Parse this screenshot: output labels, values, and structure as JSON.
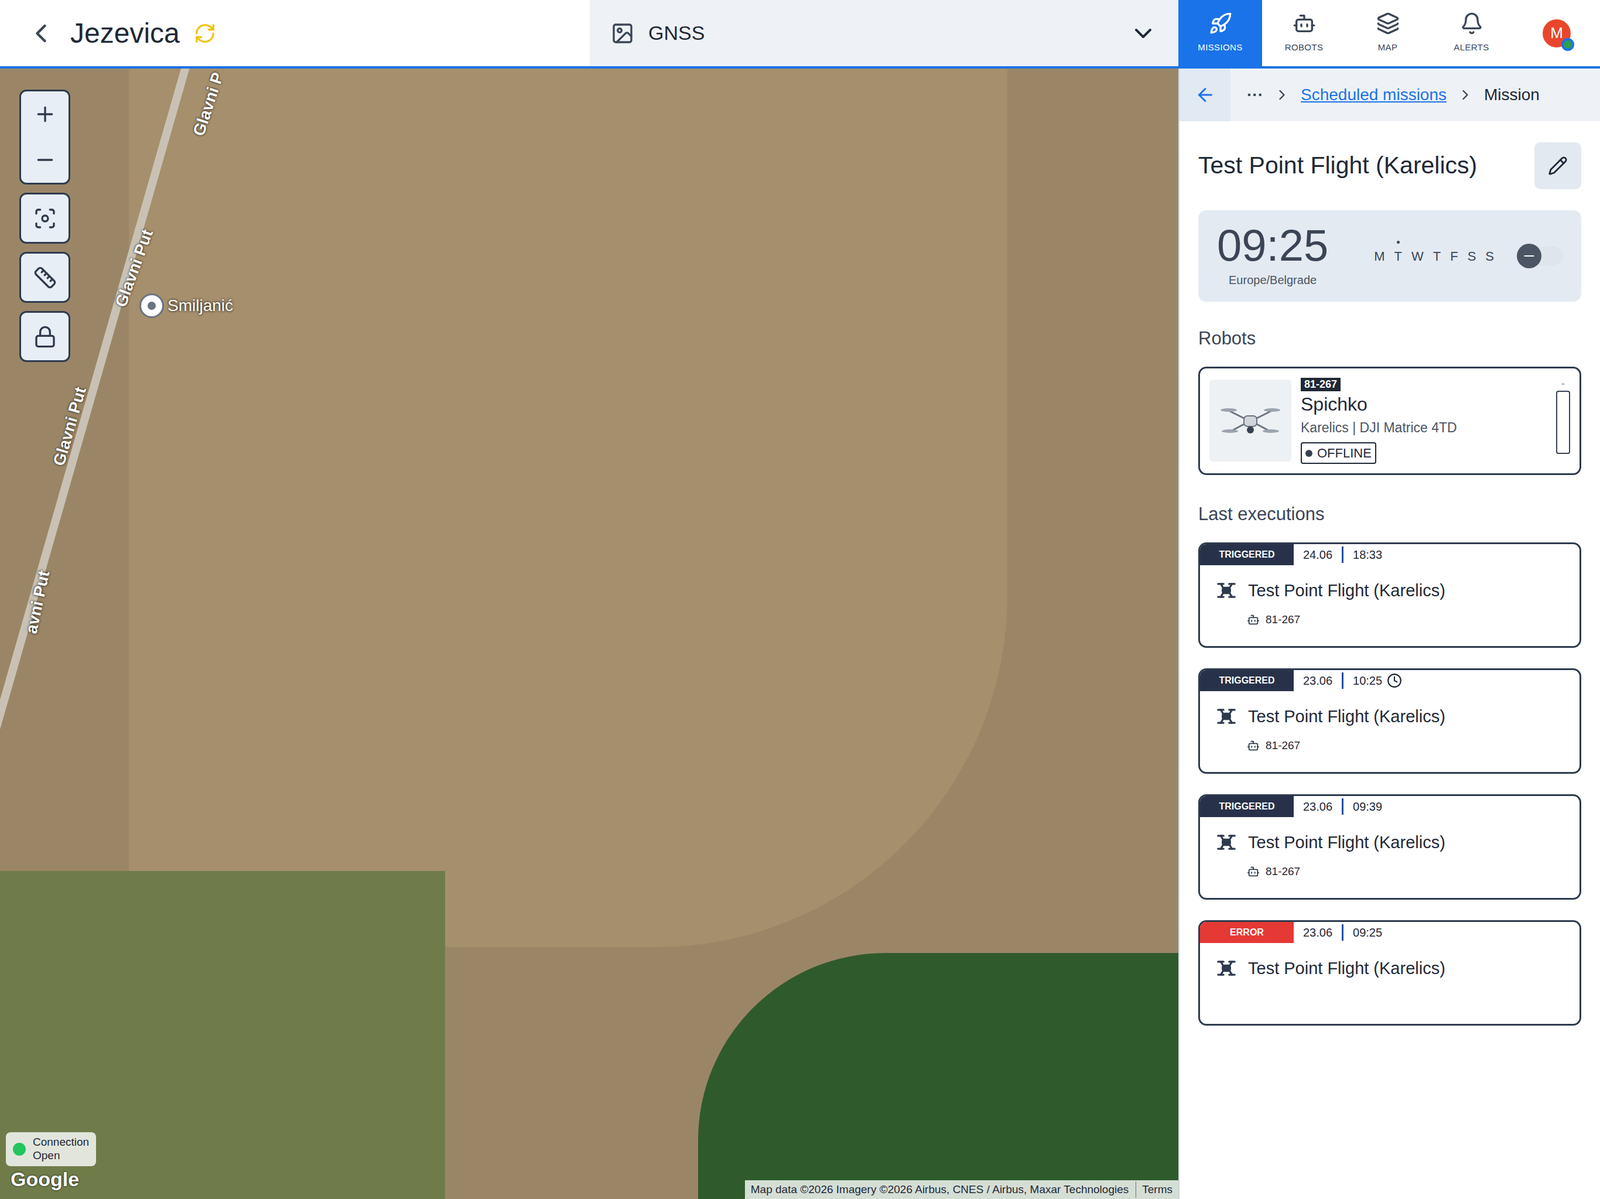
{
  "header": {
    "title": "Jezevica",
    "layer": "GNSS"
  },
  "nav": [
    {
      "label": "MISSIONS",
      "selected": true
    },
    {
      "label": "ROBOTS",
      "selected": false
    },
    {
      "label": "MAP",
      "selected": false
    },
    {
      "label": "ALERTS",
      "selected": false
    }
  ],
  "user": {
    "initial": "M",
    "online": true
  },
  "map": {
    "roads": [
      "Glavni P",
      "Glavni Put",
      "Glavni Put",
      "avni Put"
    ],
    "pin": {
      "label": "Smiljanić"
    },
    "connection": {
      "label": "Connection",
      "state": "Open",
      "connected": true
    },
    "logo": "Google",
    "attribution": "Map data ©2026 Imagery ©2026 Airbus, CNES / Airbus, Maxar Technologies",
    "terms": "Terms"
  },
  "breadcrumb": {
    "more": "···",
    "items": [
      {
        "label": "Scheduled missions",
        "link": true
      },
      {
        "label": "Mission",
        "link": false
      }
    ]
  },
  "mission": {
    "title": "Test Point Flight (Karelics)",
    "schedule": {
      "time": "09:25",
      "timezone": "Europe/Belgrade",
      "days": [
        {
          "label": "M",
          "marked": false
        },
        {
          "label": "T",
          "marked": true
        },
        {
          "label": "W",
          "marked": false
        },
        {
          "label": "T",
          "marked": false
        },
        {
          "label": "F",
          "marked": false
        },
        {
          "label": "S",
          "marked": false
        },
        {
          "label": "S",
          "marked": false
        }
      ],
      "enabled": false
    }
  },
  "robots_title": "Robots",
  "robots": [
    {
      "id": "81-267",
      "name": "Spichko",
      "details": "Karelics | DJI Matrice 4TD",
      "status": "OFFLINE",
      "battery_reading": "-",
      "level": 0
    }
  ],
  "executions_title": "Last executions",
  "executions": [
    {
      "status": "TRIGGERED",
      "color": "#27324a",
      "date": "24.06",
      "time": "18:33",
      "delayed": false,
      "title": "Test Point Flight (Karelics)",
      "robot": "81-267"
    },
    {
      "status": "TRIGGERED",
      "color": "#27324a",
      "date": "23.06",
      "time": "10:25",
      "delayed": true,
      "title": "Test Point Flight (Karelics)",
      "robot": "81-267"
    },
    {
      "status": "TRIGGERED",
      "color": "#27324a",
      "date": "23.06",
      "time": "09:39",
      "delayed": false,
      "title": "Test Point Flight (Karelics)",
      "robot": "81-267"
    },
    {
      "status": "ERROR",
      "color": "#e53935",
      "date": "23.06",
      "time": "09:25",
      "delayed": false,
      "title": "Test Point Flight (Karelics)"
    }
  ]
}
